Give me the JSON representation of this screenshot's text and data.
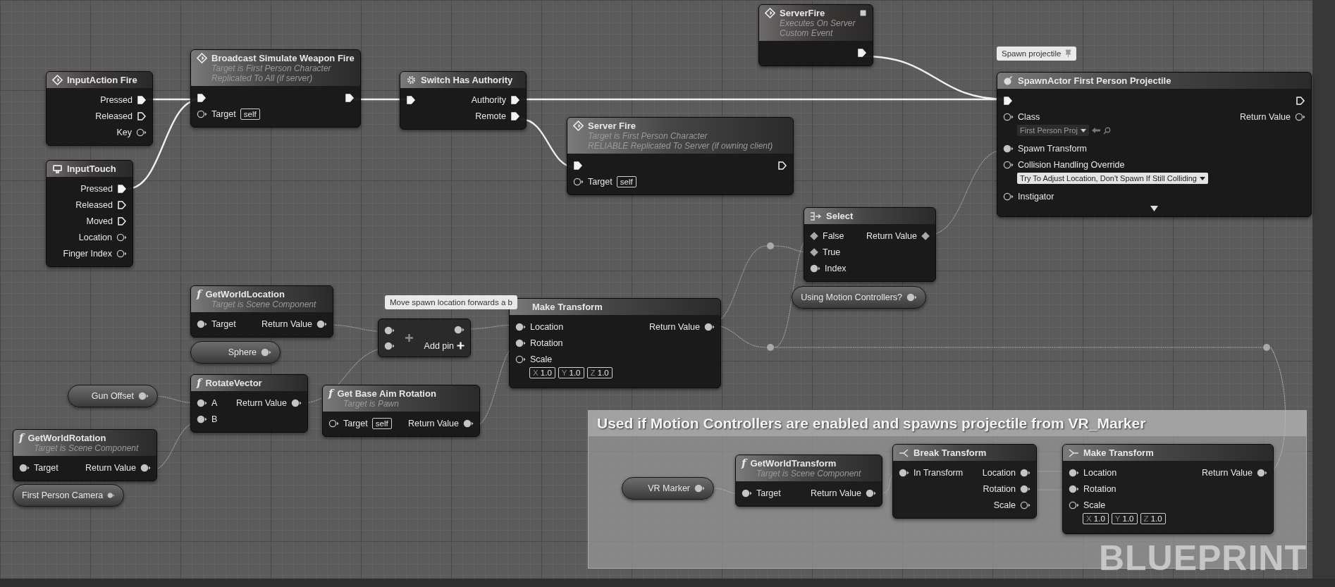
{
  "nodes": [
    {
      "kind": "event",
      "title": "InputAction Fire",
      "rows": [
        {
          "out": {
            "kind": "exec",
            "label": "Pressed",
            "connected": true
          }
        },
        {
          "out": {
            "kind": "exec",
            "label": "Released",
            "connected": false
          }
        },
        {
          "out": {
            "kind": "data",
            "label": "Key",
            "connected": false
          }
        }
      ]
    },
    {
      "kind": "event",
      "title": "InputTouch",
      "rows": [
        {
          "out": {
            "kind": "exec",
            "label": "Pressed",
            "connected": true
          }
        },
        {
          "out": {
            "kind": "exec",
            "label": "Released",
            "connected": false
          }
        },
        {
          "out": {
            "kind": "exec",
            "label": "Moved",
            "connected": false
          }
        },
        {
          "out": {
            "kind": "data",
            "label": "Location",
            "connected": false
          }
        },
        {
          "out": {
            "kind": "data",
            "label": "Finger Index",
            "connected": false
          }
        }
      ]
    },
    {
      "kind": "call",
      "title": "Broadcast Simulate Weapon Fire",
      "subtitle": [
        "Target is First Person Character",
        "Replicated To All (if server)"
      ],
      "rows": [
        {
          "in": {
            "kind": "exec",
            "connected": true
          },
          "out": {
            "kind": "exec",
            "connected": true
          }
        },
        {
          "in": {
            "kind": "data",
            "label": "Target",
            "connected": false,
            "value": {
              "kind": "box",
              "text": "self"
            }
          }
        }
      ]
    },
    {
      "kind": "call",
      "title": "Switch Has Authority",
      "rows": [
        {
          "in": {
            "kind": "exec",
            "connected": true
          },
          "out": {
            "kind": "exec",
            "label": "Authority",
            "connected": true
          }
        },
        {
          "out": {
            "kind": "exec",
            "label": "Remote",
            "connected": true
          }
        }
      ]
    },
    {
      "kind": "event",
      "title": "ServerFire",
      "subtitle": [
        "Executes On Server",
        "Custom Event"
      ],
      "flag": true,
      "rows": [
        {
          "out": {
            "kind": "exec",
            "connected": true
          }
        }
      ]
    },
    {
      "kind": "call",
      "title": "Server Fire",
      "subtitle": [
        "Target is First Person Character",
        "RELIABLE Replicated To Server (if owning client)"
      ],
      "rows": [
        {
          "in": {
            "kind": "exec",
            "connected": true
          },
          "out": {
            "kind": "exec",
            "connected": false
          }
        },
        {
          "in": {
            "kind": "data",
            "label": "Target",
            "connected": false,
            "value": {
              "kind": "box",
              "text": "self"
            }
          }
        }
      ]
    },
    {
      "kind": "call",
      "title": "SpawnActor First Person Projectile",
      "expandable": true,
      "rows": [
        {
          "in": {
            "kind": "exec",
            "connected": true
          },
          "out": {
            "kind": "exec",
            "connected": false
          }
        },
        {
          "in": {
            "kind": "data",
            "label": "Class",
            "connected": false,
            "value": {
              "kind": "asset",
              "text": "First Person Proj"
            }
          },
          "out": {
            "kind": "data",
            "label": "Return Value",
            "connected": false
          }
        },
        {
          "in": {
            "kind": "data",
            "label": "Spawn Transform",
            "connected": true
          }
        },
        {
          "in": {
            "kind": "data",
            "label": "Collision Handling Override",
            "connected": false,
            "value": {
              "kind": "dropdown",
              "text": "Try To Adjust Location, Don't Spawn If Still Colliding"
            }
          }
        },
        {
          "in": {
            "kind": "data",
            "label": "Instigator",
            "connected": false
          }
        }
      ]
    },
    {
      "kind": "call",
      "title": "Select",
      "rows": [
        {
          "in": {
            "kind": "diamond",
            "label": "False",
            "connected": true
          },
          "out": {
            "kind": "diamond",
            "label": "Return Value",
            "connected": true
          }
        },
        {
          "in": {
            "kind": "diamond",
            "label": "True",
            "connected": true
          }
        },
        {
          "in": {
            "kind": "data",
            "label": "Index",
            "connected": true
          }
        }
      ]
    },
    {
      "kind": "call",
      "glyph": "f",
      "title": "GetWorldLocation",
      "subtitle": [
        "Target is Scene Component"
      ],
      "rows": [
        {
          "in": {
            "kind": "data",
            "label": "Target",
            "connected": true
          },
          "out": {
            "kind": "data",
            "label": "Return Value",
            "connected": true
          }
        }
      ]
    },
    {
      "kind": "variable",
      "title": "Using Motion Controllers?",
      "pin": {
        "kind": "data",
        "connected": true
      }
    },
    {
      "kind": "variable",
      "title": "Sphere",
      "pin": {
        "kind": "data",
        "connected": true
      }
    },
    {
      "kind": "operator",
      "inputs": [
        {
          "connected": true
        },
        {
          "connected": true
        }
      ],
      "output": {
        "connected": true
      },
      "add_pin": "Add pin"
    },
    {
      "kind": "call",
      "title": "Make Transform",
      "rows": [
        {
          "in": {
            "kind": "data",
            "label": "Location",
            "connected": true
          },
          "out": {
            "kind": "data",
            "label": "Return Value",
            "connected": true
          }
        },
        {
          "in": {
            "kind": "data",
            "label": "Rotation",
            "connected": true
          }
        },
        {
          "in": {
            "kind": "data",
            "label": "Scale",
            "connected": false,
            "value": {
              "kind": "vector",
              "items": [
                {
                  "axis": "X",
                  "text": "1.0"
                },
                {
                  "axis": "Y",
                  "text": "1.0"
                },
                {
                  "axis": "Z",
                  "text": "1.0"
                }
              ]
            }
          }
        }
      ]
    },
    {
      "kind": "call",
      "glyph": "f",
      "title": "RotateVector",
      "rows": [
        {
          "in": {
            "kind": "data",
            "label": "A",
            "connected": true
          },
          "out": {
            "kind": "data",
            "label": "Return Value",
            "connected": true
          }
        },
        {
          "in": {
            "kind": "data",
            "label": "B",
            "connected": true
          }
        }
      ]
    },
    {
      "kind": "variable",
      "title": "Gun Offset",
      "pin": {
        "kind": "data",
        "connected": true
      }
    },
    {
      "kind": "call",
      "glyph": "f",
      "title": "Get Base Aim Rotation",
      "subtitle": [
        "Target is Pawn"
      ],
      "rows": [
        {
          "in": {
            "kind": "data",
            "label": "Target",
            "connected": false,
            "value": {
              "kind": "box",
              "text": "self"
            }
          },
          "out": {
            "kind": "data",
            "label": "Return Value",
            "connected": true
          }
        }
      ]
    },
    {
      "kind": "call",
      "glyph": "f",
      "title": "GetWorldRotation",
      "subtitle": [
        "Target is Scene Component"
      ],
      "rows": [
        {
          "in": {
            "kind": "data",
            "label": "Target",
            "connected": true
          },
          "out": {
            "kind": "data",
            "label": "Return Value",
            "connected": true
          }
        }
      ]
    },
    {
      "kind": "variable",
      "title": "First Person Camera",
      "pin": {
        "kind": "data",
        "connected": true
      }
    },
    {
      "kind": "variable",
      "title": "VR Marker",
      "pin": {
        "kind": "data",
        "connected": true
      }
    },
    {
      "kind": "call",
      "glyph": "f",
      "title": "GetWorldTransform",
      "subtitle": [
        "Target is Scene Component"
      ],
      "rows": [
        {
          "in": {
            "kind": "data",
            "label": "Target",
            "connected": true
          },
          "out": {
            "kind": "data",
            "label": "Return Value",
            "connected": true
          }
        }
      ]
    },
    {
      "kind": "call",
      "title": "Break Transform",
      "rows": [
        {
          "in": {
            "kind": "data",
            "label": "In Transform",
            "connected": true
          },
          "out": {
            "kind": "data",
            "label": "Location",
            "connected": true
          }
        },
        {
          "out": {
            "kind": "data",
            "label": "Rotation",
            "connected": true
          }
        },
        {
          "out": {
            "kind": "data",
            "label": "Scale",
            "connected": false
          }
        }
      ]
    },
    {
      "kind": "call",
      "title": "Make Transform",
      "rows": [
        {
          "in": {
            "kind": "data",
            "label": "Location",
            "connected": true
          },
          "out": {
            "kind": "data",
            "label": "Return Value",
            "connected": true
          }
        },
        {
          "in": {
            "kind": "data",
            "label": "Rotation",
            "connected": true
          }
        },
        {
          "in": {
            "kind": "data",
            "label": "Scale",
            "connected": false,
            "value": {
              "kind": "vector",
              "items": [
                {
                  "axis": "X",
                  "text": "1.0"
                },
                {
                  "axis": "Y",
                  "text": "1.0"
                },
                {
                  "axis": "Z",
                  "text": "1.0"
                }
              ]
            }
          }
        }
      ]
    }
  ],
  "bubbles": [
    {
      "text": "Spawn projectile",
      "pinned": true
    },
    {
      "text": "Move spawn location forwards a b",
      "pinned": false
    }
  ],
  "comment": {
    "title": "Used if Motion Controllers are enabled and spawns projectile from VR_Marker"
  },
  "watermark": "BLUEPRINT"
}
